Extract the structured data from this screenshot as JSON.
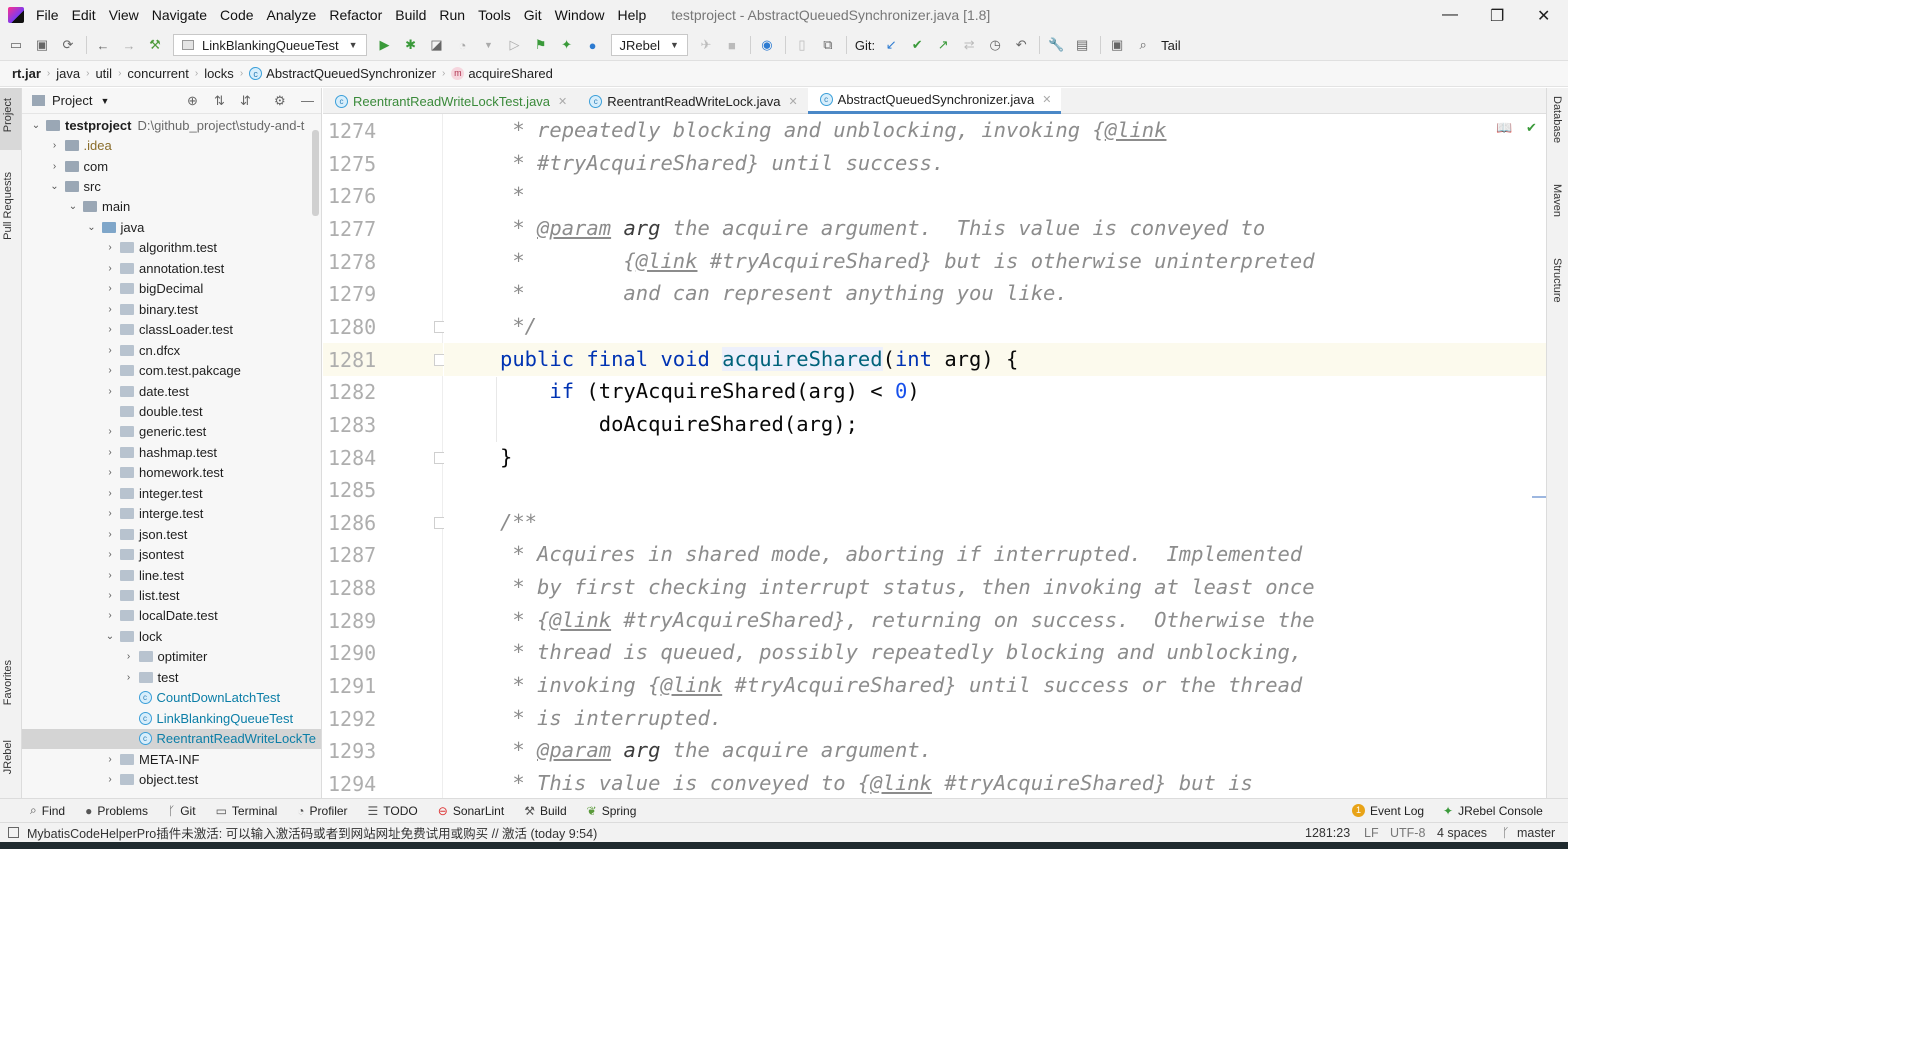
{
  "menu": {
    "items": [
      "File",
      "Edit",
      "View",
      "Navigate",
      "Code",
      "Analyze",
      "Refactor",
      "Build",
      "Run",
      "Tools",
      "Git",
      "Window",
      "Help"
    ],
    "window_title": "testproject - AbstractQueuedSynchronizer.java [1.8]"
  },
  "toolbar": {
    "run_config": "LinkBlankingQueueTest",
    "jrebel_combo": "JRebel",
    "git_label": "Git:",
    "tail_label": "Tail"
  },
  "breadcrumb": [
    "rt.jar",
    "java",
    "util",
    "concurrent",
    "locks",
    "AbstractQueuedSynchronizer",
    "acquireShared"
  ],
  "left_stripe": {
    "project": "Project",
    "pull_requests": "Pull Requests",
    "favorites": "Favorites",
    "jrebel": "JRebel"
  },
  "right_stripe": {
    "database": "Database",
    "maven": "Maven",
    "structure": "Structure"
  },
  "project_panel": {
    "title": "Project",
    "tree": [
      {
        "label": "testproject",
        "extra": "D:\\github_project\\study-and-t",
        "depth": 0,
        "chevron": "down",
        "icon": "folder",
        "style": "bold"
      },
      {
        "label": ".idea",
        "depth": 1,
        "chevron": "right",
        "icon": "folder",
        "style": "brown"
      },
      {
        "label": "com",
        "depth": 1,
        "chevron": "right",
        "icon": "folder",
        "style": ""
      },
      {
        "label": "src",
        "depth": 1,
        "chevron": "down",
        "icon": "folder",
        "style": ""
      },
      {
        "label": "main",
        "depth": 2,
        "chevron": "down",
        "icon": "folder",
        "style": ""
      },
      {
        "label": "java",
        "depth": 3,
        "chevron": "down",
        "icon": "folder-blue",
        "style": ""
      },
      {
        "label": "algorithm.test",
        "depth": 4,
        "chevron": "right",
        "icon": "package",
        "style": ""
      },
      {
        "label": "annotation.test",
        "depth": 4,
        "chevron": "right",
        "icon": "package",
        "style": ""
      },
      {
        "label": "bigDecimal",
        "depth": 4,
        "chevron": "right",
        "icon": "package",
        "style": ""
      },
      {
        "label": "binary.test",
        "depth": 4,
        "chevron": "right",
        "icon": "package",
        "style": ""
      },
      {
        "label": "classLoader.test",
        "depth": 4,
        "chevron": "right",
        "icon": "package",
        "style": ""
      },
      {
        "label": "cn.dfcx",
        "depth": 4,
        "chevron": "right",
        "icon": "package",
        "style": ""
      },
      {
        "label": "com.test.pakcage",
        "depth": 4,
        "chevron": "right",
        "icon": "package",
        "style": ""
      },
      {
        "label": "date.test",
        "depth": 4,
        "chevron": "right",
        "icon": "package",
        "style": ""
      },
      {
        "label": "double.test",
        "depth": 4,
        "chevron": "none",
        "icon": "package",
        "style": ""
      },
      {
        "label": "generic.test",
        "depth": 4,
        "chevron": "right",
        "icon": "package",
        "style": ""
      },
      {
        "label": "hashmap.test",
        "depth": 4,
        "chevron": "right",
        "icon": "package",
        "style": ""
      },
      {
        "label": "homework.test",
        "depth": 4,
        "chevron": "right",
        "icon": "package",
        "style": ""
      },
      {
        "label": "integer.test",
        "depth": 4,
        "chevron": "right",
        "icon": "package",
        "style": ""
      },
      {
        "label": "interge.test",
        "depth": 4,
        "chevron": "right",
        "icon": "package",
        "style": ""
      },
      {
        "label": "json.test",
        "depth": 4,
        "chevron": "right",
        "icon": "package",
        "style": ""
      },
      {
        "label": "jsontest",
        "depth": 4,
        "chevron": "right",
        "icon": "package",
        "style": ""
      },
      {
        "label": "line.test",
        "depth": 4,
        "chevron": "right",
        "icon": "package",
        "style": ""
      },
      {
        "label": "list.test",
        "depth": 4,
        "chevron": "right",
        "icon": "package",
        "style": ""
      },
      {
        "label": "localDate.test",
        "depth": 4,
        "chevron": "right",
        "icon": "package",
        "style": ""
      },
      {
        "label": "lock",
        "depth": 4,
        "chevron": "down",
        "icon": "package",
        "style": ""
      },
      {
        "label": "optimiter",
        "depth": 5,
        "chevron": "right",
        "icon": "package",
        "style": ""
      },
      {
        "label": "test",
        "depth": 5,
        "chevron": "right",
        "icon": "package",
        "style": ""
      },
      {
        "label": "CountDownLatchTest",
        "depth": 5,
        "chevron": "none",
        "icon": "class",
        "style": "cyan"
      },
      {
        "label": "LinkBlankingQueueTest",
        "depth": 5,
        "chevron": "none",
        "icon": "class",
        "style": "cyan"
      },
      {
        "label": "ReentrantReadWriteLockTe",
        "depth": 5,
        "chevron": "none",
        "icon": "class",
        "style": "cyan",
        "selected": true
      },
      {
        "label": "META-INF",
        "depth": 4,
        "chevron": "right",
        "icon": "package",
        "style": ""
      },
      {
        "label": "object.test",
        "depth": 4,
        "chevron": "right",
        "icon": "package",
        "style": ""
      }
    ]
  },
  "editor_tabs": [
    {
      "label": "ReentrantReadWriteLockTest.java",
      "active": false,
      "color": "green"
    },
    {
      "label": "ReentrantReadWriteLock.java",
      "active": false,
      "color": ""
    },
    {
      "label": "AbstractQueuedSynchronizer.java",
      "active": true,
      "color": ""
    }
  ],
  "editor": {
    "current_line": 1281,
    "lines": [
      {
        "no": "1274",
        "html": "<span class='cm'> * repeatedly blocking and unblocking, invoking {<span class='tag'>@link</span></span>"
      },
      {
        "no": "1275",
        "html": "<span class='cm'> * #tryAcquireShared} until success.</span>"
      },
      {
        "no": "1276",
        "html": "<span class='cm'> *</span>"
      },
      {
        "no": "1277",
        "html": "<span class='cm'> * <span class='tag'>@param</span> <span style='color:#3d3d3d;font-style:italic'>arg</span> the acquire argument.  This value is conveyed to</span>"
      },
      {
        "no": "1278",
        "html": "<span class='cm'> *        {<span class='tag'>@link</span> #tryAcquireShared} but is otherwise uninterpreted</span>"
      },
      {
        "no": "1279",
        "html": "<span class='cm'> *        and can represent anything you like.</span>"
      },
      {
        "no": "1280",
        "html": "<span class='cm'> */</span>"
      },
      {
        "no": "1281",
        "html": "<span class='kw'>public final void</span> <span class='fn hl'>acquireShared</span>(<span class='kw'>int</span> arg) {"
      },
      {
        "no": "1282",
        "html": "    <span class='kw'>if</span> (tryAcquireShared(arg) &lt; <span class='num'>0</span>)"
      },
      {
        "no": "1283",
        "html": "        doAcquireShared(arg);"
      },
      {
        "no": "1284",
        "html": "}"
      },
      {
        "no": "1285",
        "html": ""
      },
      {
        "no": "1286",
        "html": "<span class='cm'>/**</span>"
      },
      {
        "no": "1287",
        "html": "<span class='cm'> * Acquires in shared mode, aborting if interrupted.  Implemented</span>"
      },
      {
        "no": "1288",
        "html": "<span class='cm'> * by first checking interrupt status, then invoking at least once</span>"
      },
      {
        "no": "1289",
        "html": "<span class='cm'> * {<span class='tag'>@link</span> #tryAcquireShared}, returning on success.  Otherwise the</span>"
      },
      {
        "no": "1290",
        "html": "<span class='cm'> * thread is queued, possibly repeatedly blocking and unblocking,</span>"
      },
      {
        "no": "1291",
        "html": "<span class='cm'> * invoking {<span class='tag'>@link</span> #tryAcquireShared} until success or the thread</span>"
      },
      {
        "no": "1292",
        "html": "<span class='cm'> * is interrupted.</span>"
      },
      {
        "no": "1293",
        "html": "<span class='cm'> * <span class='tag'>@param</span> <span style='color:#3d3d3d;font-style:italic'>arg</span> the acquire argument.</span>"
      },
      {
        "no": "1294",
        "html": "<span class='cm'> * This value is conveyed to {<span class='tag'>@link</span> #tryAcquireShared} but is</span>"
      }
    ]
  },
  "bottom_tools": [
    {
      "label": "Find",
      "icon": "search-icon"
    },
    {
      "label": "Problems",
      "icon": "problems-icon"
    },
    {
      "label": "Git",
      "icon": "git-icon"
    },
    {
      "label": "Terminal",
      "icon": "terminal-icon"
    },
    {
      "label": "Profiler",
      "icon": "profiler-icon"
    },
    {
      "label": "TODO",
      "icon": "todo-icon"
    },
    {
      "label": "SonarLint",
      "icon": "sonarlint-icon"
    },
    {
      "label": "Build",
      "icon": "build-icon"
    },
    {
      "label": "Spring",
      "icon": "spring-icon"
    }
  ],
  "right_tools": {
    "event_log_badge": "1",
    "event_log": "Event Log",
    "jrebel_console": "JRebel Console"
  },
  "statusbar": {
    "message": "MybatisCodeHelperPro插件未激活: 可以输入激活码或者到网站网址免费试用或购买 // 激活 (today 9:54)",
    "position": "1281:23",
    "line_sep": "LF",
    "encoding": "UTF-8",
    "indent": "4 spaces",
    "branch": "master"
  },
  "colors": {
    "accent": "#4a88c7",
    "keyword": "#0033b3",
    "comment": "#8c8c8c",
    "current_line": "#fcfaed"
  }
}
